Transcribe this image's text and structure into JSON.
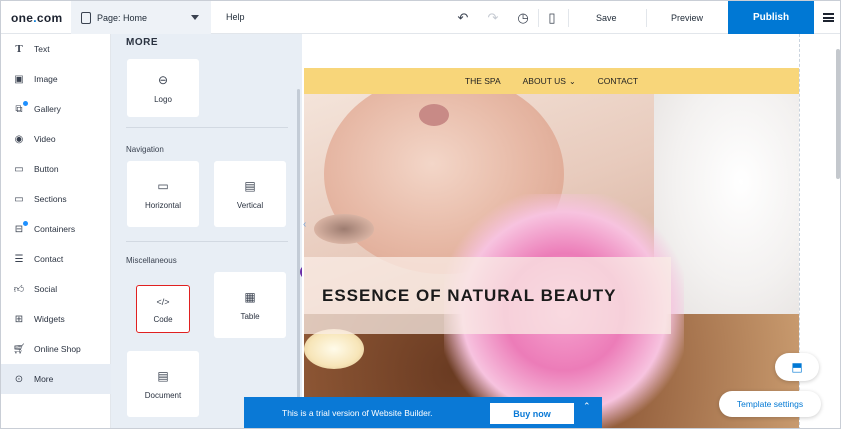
{
  "topbar": {
    "logo_main": "one",
    "logo_dot": ".",
    "logo_tail": "com",
    "page_selector": "Page: Home",
    "help": "Help",
    "save": "Save",
    "preview": "Preview",
    "publish": "Publish"
  },
  "sidebar": {
    "items": [
      {
        "label": "Text",
        "icon": "text-icon"
      },
      {
        "label": "Image",
        "icon": "image-icon"
      },
      {
        "label": "Gallery",
        "icon": "gallery-icon"
      },
      {
        "label": "Video",
        "icon": "play-icon"
      },
      {
        "label": "Button",
        "icon": "button-icon"
      },
      {
        "label": "Sections",
        "icon": "sections-icon"
      },
      {
        "label": "Containers",
        "icon": "containers-icon"
      },
      {
        "label": "Contact",
        "icon": "contact-icon"
      },
      {
        "label": "Social",
        "icon": "thumbs-up-icon"
      },
      {
        "label": "Widgets",
        "icon": "widgets-icon"
      },
      {
        "label": "Online Shop",
        "icon": "cart-icon"
      },
      {
        "label": "More",
        "icon": "more-icon"
      }
    ]
  },
  "panel": {
    "title": "MORE",
    "logo_card": "Logo",
    "navigation_title": "Navigation",
    "horizontal": "Horizontal",
    "vertical": "Vertical",
    "misc_title": "Miscellaneous",
    "code": "Code",
    "table": "Table",
    "document": "Document"
  },
  "site": {
    "nav": [
      "THE SPA",
      "ABOUT US",
      "CONTACT"
    ],
    "hero_title": "ESSENCE OF NATURAL BEAUTY"
  },
  "trial": {
    "text": "This is a trial version of Website Builder.",
    "buy_now": "Buy now"
  },
  "template_settings": "Template settings",
  "colors": {
    "accent": "#0078d4",
    "nav_bar": "#f8d67a",
    "selection": "#e02020",
    "badge": "#6b2ea8"
  }
}
